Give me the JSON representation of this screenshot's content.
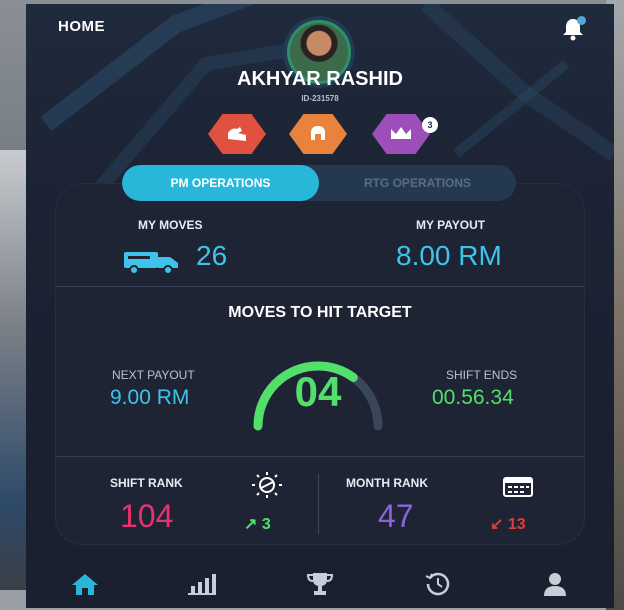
{
  "header": {
    "title": "HOME"
  },
  "user": {
    "name": "AKHYAR RASHID",
    "id": "ID-231578"
  },
  "badges": [
    {
      "icon": "flexed-arm-icon",
      "color": "#e0513e"
    },
    {
      "icon": "helmet-icon",
      "color": "#e9823c"
    },
    {
      "icon": "crown-icon",
      "color": "#9c4fb8",
      "count": "3"
    }
  ],
  "tabs": [
    {
      "label": "PM OPERATIONS",
      "active": true
    },
    {
      "label": "RTG OPERATIONS",
      "active": false
    }
  ],
  "stats": {
    "moves_label": "MY MOVES",
    "moves_value": "26",
    "payout_label": "MY PAYOUT",
    "payout_value": "8.00 RM"
  },
  "target": {
    "title": "MOVES TO HIT TARGET",
    "value": "04",
    "progress": 0.7,
    "next_payout_label": "NEXT PAYOUT",
    "next_payout_value": "9.00 RM",
    "shift_ends_label": "SHIFT ENDS",
    "shift_ends_value": "00.56.34"
  },
  "ranks": {
    "shift_label": "SHIFT RANK",
    "shift_value": "104",
    "shift_trend": "3",
    "month_label": "MONTH RANK",
    "month_value": "47",
    "month_trend": "13"
  },
  "colors": {
    "accent": "#29b7d9",
    "payout": "#3ec4ea",
    "green": "#52e06a",
    "pink": "#e9316f",
    "purple": "#8e63d8",
    "red": "#e23b3b"
  },
  "nav": [
    "home-icon",
    "chart-icon",
    "trophy-icon",
    "history-icon",
    "profile-icon"
  ]
}
